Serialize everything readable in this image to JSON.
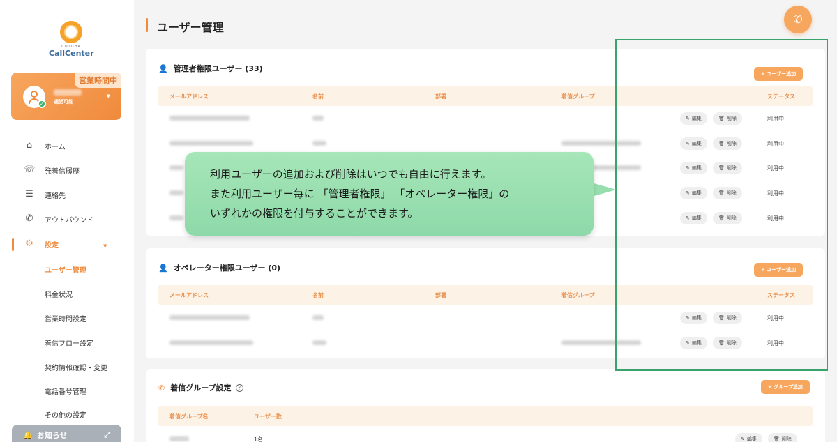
{
  "app": {
    "logo_small": "COTOHA",
    "logo_text": "CallCenter",
    "page_title": "ユーザー管理"
  },
  "user_card": {
    "badge": "営業時間中",
    "status": "通話可能"
  },
  "nav": {
    "home": "ホーム",
    "history": "発着信履歴",
    "contacts": "連絡先",
    "outbound": "アウトバウンド",
    "settings": "設定",
    "sub": {
      "users": "ユーザー管理",
      "billing": "料金状況",
      "hours": "営業時間設定",
      "flow": "着信フロー設定",
      "contract": "契約情報確認・変更",
      "phone": "電話番号管理",
      "other": "その他の設定"
    },
    "notice": "お知らせ"
  },
  "admin_card": {
    "title": "管理者権限ユーザー (33)",
    "add_label": "+ ユーザー追加",
    "columns": [
      "メールアドレス",
      "名前",
      "部署",
      "着信グループ",
      "ステータス"
    ],
    "rows": [
      {
        "status": "利用中"
      },
      {
        "status": "利用中"
      },
      {
        "status": "利用中"
      },
      {
        "status": "利用中"
      },
      {
        "status": "利用中"
      }
    ]
  },
  "operator_card": {
    "title": "オペレーター権限ユーザー (0)",
    "add_label": "+ ユーザー追加",
    "columns": [
      "メールアドレス",
      "名前",
      "部署",
      "着信グループ",
      "ステータス"
    ],
    "rows": [
      {
        "status": "利用中"
      },
      {
        "status": "利用中"
      }
    ]
  },
  "group_card": {
    "title": "着信グループ設定",
    "add_label": "+ グループ追加",
    "columns": [
      "着信グループ名",
      "ユーザー数"
    ],
    "rows": [
      {
        "count": "1名"
      }
    ]
  },
  "buttons": {
    "edit": "編集",
    "delete": "削除"
  },
  "callout": {
    "line1": "利用ユーザーの追加および削除はいつでも自由に行えます。",
    "line2": "また利用ユーザー毎に 「管理者権限」 「オペレーター権限」の",
    "line3": "いずれかの権限を付与することができます。"
  },
  "colors": {
    "accent": "#f08a3c",
    "accent_light": "#f7a65e",
    "highlight": "#3aa36b",
    "callout": "#a6e6b8"
  }
}
